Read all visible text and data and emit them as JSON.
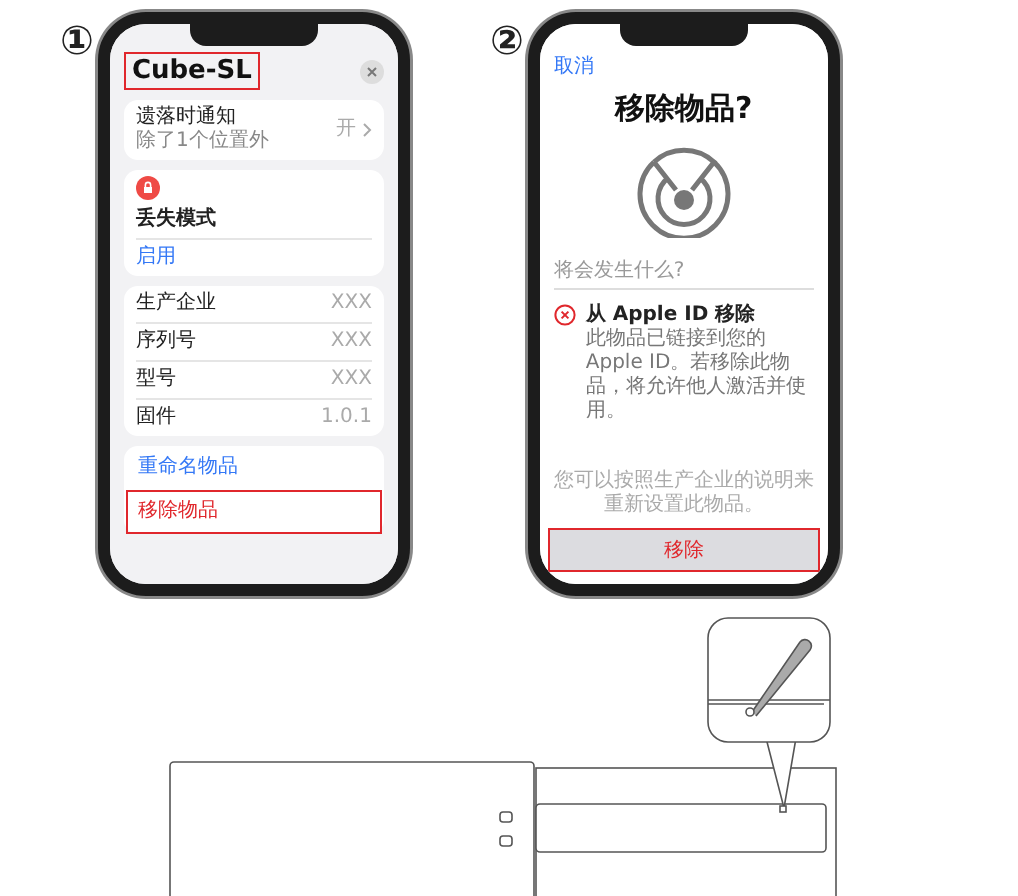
{
  "steps": [
    {
      "number": "①",
      "kind": "item-details",
      "title": {
        "text": "Cube-SL",
        "highlighted": true
      },
      "notify": {
        "label": "遗落时通知",
        "sublabel": "除了1个位置外",
        "value": "开"
      },
      "lost_mode": {
        "label": "丢失模式",
        "action": "启用"
      },
      "info_rows": [
        {
          "label": "生产企业",
          "value": "XXX"
        },
        {
          "label": "序列号",
          "value": "XXX"
        },
        {
          "label": "型号",
          "value": "XXX"
        },
        {
          "label": "固件",
          "value": "1.0.1"
        }
      ],
      "actions": [
        {
          "label": "重命名物品",
          "kind": "normal",
          "highlighted": false
        },
        {
          "label": "移除物品",
          "kind": "destructive",
          "highlighted": true
        }
      ]
    },
    {
      "number": "②",
      "kind": "remove-confirm",
      "cancel": "取消",
      "title": "移除物品?",
      "section_label": "将会发生什么?",
      "effect": {
        "title": "从 Apple ID 移除",
        "description": "此物品已链接到您的Apple ID。若移除此物品，将允许他人激活并使用。"
      },
      "footer": "您可以按照生产企业的说明来重新设置此物品。",
      "button": {
        "label": "移除",
        "highlighted": true
      }
    }
  ]
}
